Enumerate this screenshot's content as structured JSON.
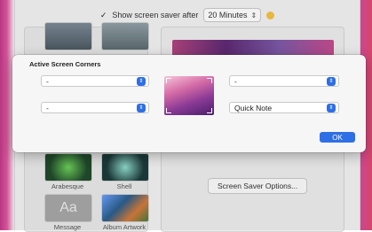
{
  "background": {
    "show_screen_saver_label": "Show screen saver after",
    "checkmark": "✓",
    "timeout_value": "20 Minutes",
    "screen_saver_options_label": "Screen Saver Options...",
    "thumbnails": [
      {
        "label": "Arabesque"
      },
      {
        "label": "Shell"
      },
      {
        "label": "Message",
        "glyph": "Aa"
      },
      {
        "label": "Album Artwork"
      }
    ]
  },
  "dialog": {
    "title": "Active Screen Corners",
    "top_left_value": "-",
    "top_right_value": "-",
    "bottom_left_value": "-",
    "bottom_right_value": "Quick Note",
    "ok_label": "OK",
    "chevron_glyph": "⌃⌄"
  },
  "colors": {
    "accent": "#2f6fe5",
    "warning": "#f5c142"
  }
}
